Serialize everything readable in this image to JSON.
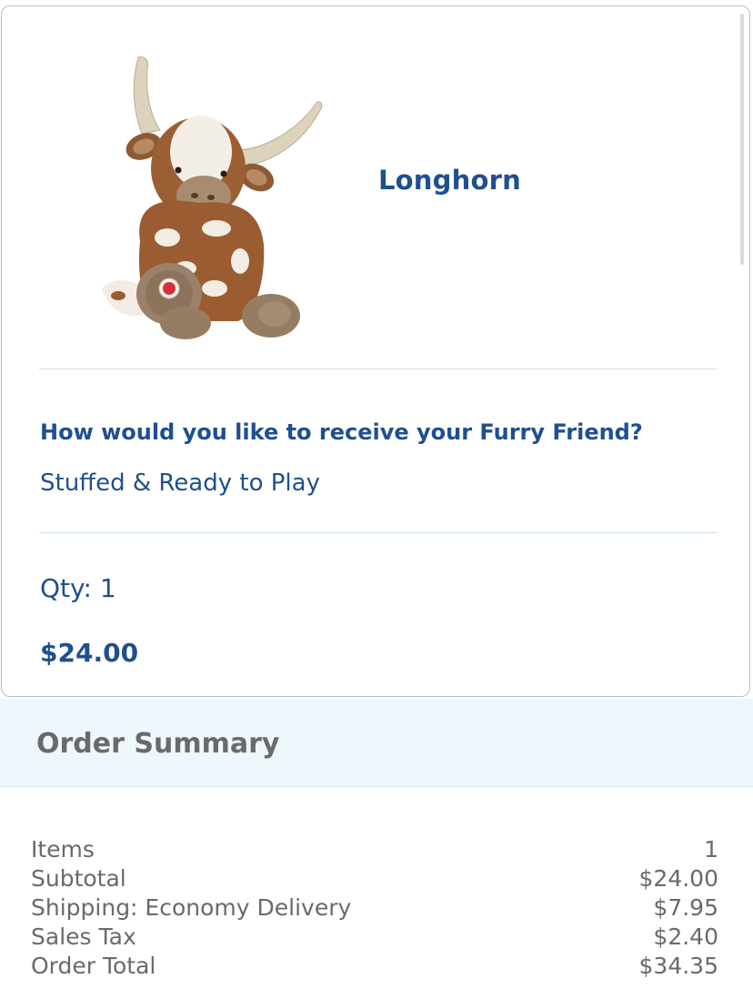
{
  "product": {
    "name": "Longhorn",
    "image_alt": "Longhorn plush toy",
    "question": "How would you like to receive your Furry Friend?",
    "answer": "Stuffed & Ready to Play",
    "qty": "Qty: 1",
    "price": "$24.00"
  },
  "summary": {
    "title": "Order Summary",
    "rows": [
      {
        "label": "Items",
        "value": "1"
      },
      {
        "label": "Subtotal",
        "value": "$24.00"
      },
      {
        "label": "Shipping: Economy Delivery",
        "value": "$7.95"
      },
      {
        "label": "Sales Tax",
        "value": "$2.40"
      },
      {
        "label": "Order Total",
        "value": "$34.35"
      }
    ]
  },
  "colors": {
    "brand_blue": "#1f4f8f",
    "summary_bg": "#eef7fc",
    "text_gray": "#6a6a6a",
    "card_border": "#a9c3d6"
  }
}
